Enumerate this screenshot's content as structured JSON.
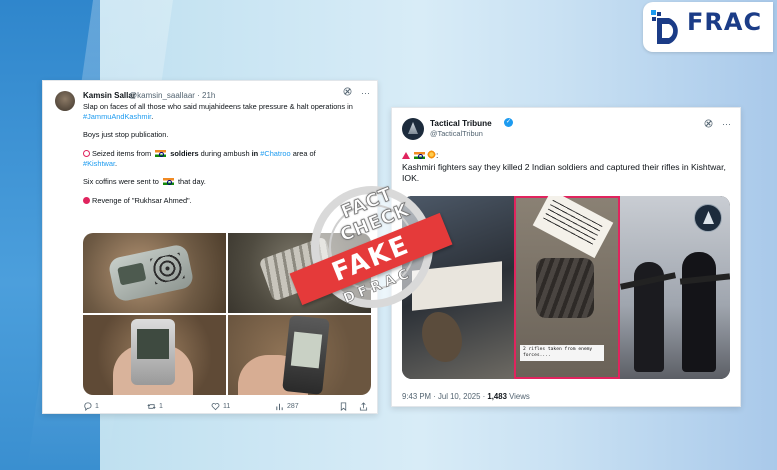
{
  "logo": {
    "text": "FRAC",
    "colors": {
      "primary": "#1b3c87",
      "accent": "#1d9bf0"
    }
  },
  "tweet_left": {
    "author_name": "Kamsin Sallar",
    "handle_time": "@kamsin_saallaar · 21h",
    "line1_pre": "Slap on faces of all those who said mujahideens take pressure & halt operations in ",
    "line1_tag": "#JammuAndKashmir",
    "line1_post": ".",
    "line2": "Boys just stop publication.",
    "line3_pre": "Seized items from ",
    "line3_bold": "soldiers",
    "line3_mid": " during ambush ",
    "line3_in": "in",
    "line3_tag1": "#Chatroo",
    "line3_area": " area of",
    "line3_tag2": "#Kishtwar",
    "line3_end": ".",
    "line4_pre": "Six coffins were sent to ",
    "line4_post": " that day.",
    "line5": "Revenge of \"Rukhsar Ahmed\".",
    "actions": {
      "replies": "1",
      "retweets": "1",
      "likes": "11",
      "views": "287"
    },
    "icons": [
      "grok-icon",
      "more-icon",
      "reply-icon",
      "retweet-icon",
      "like-icon",
      "views-icon",
      "bookmark-icon",
      "share-icon"
    ]
  },
  "tweet_right": {
    "author_name": "Tactical Tribune",
    "handle": "@TacticalTribun",
    "body": "Kashmiri fighters say they killed 2 Indian soldiers and captured their rifles in Kishtwar, IOK.",
    "emoji_suffix": ":",
    "caption": "2 rifles taken from enemy forces....",
    "timestamp": "9:43 PM · Jul 10, 2025 · ",
    "views": "1,483",
    "views_label": " Views",
    "verified_color": "#1d9bf0"
  },
  "stamp": {
    "top": "FACT CHECK",
    "fake": "FAKE",
    "bottom": "DFRAC",
    "color": "#e53a3a"
  }
}
